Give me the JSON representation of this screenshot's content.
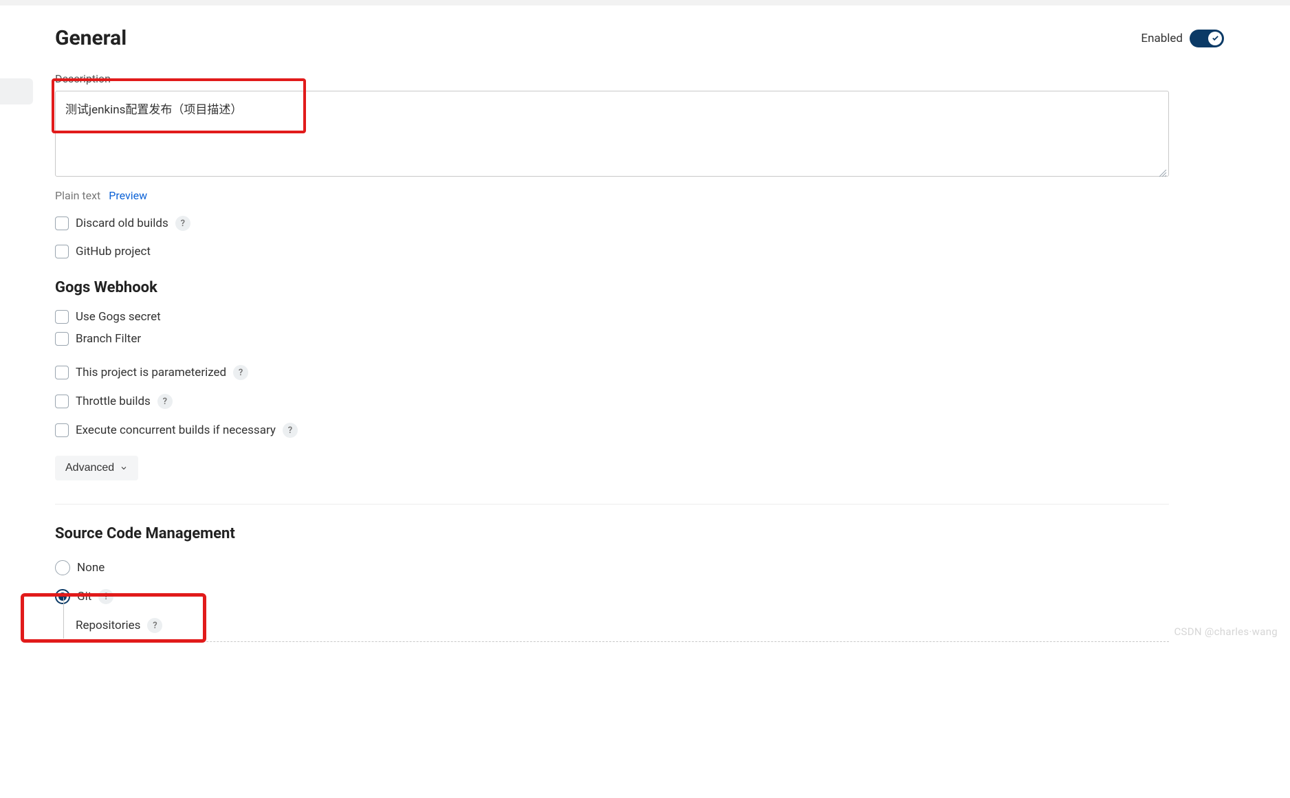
{
  "header": {
    "title": "General",
    "enabled_label": "Enabled"
  },
  "description": {
    "label": "Description",
    "value": "测试jenkins配置发布（项目描述）",
    "plain_text_label": "Plain text",
    "preview_label": "Preview"
  },
  "general_options": {
    "discard_old_builds": "Discard old builds",
    "github_project": "GitHub project"
  },
  "gogs": {
    "heading": "Gogs Webhook",
    "use_secret": "Use Gogs secret",
    "branch_filter": "Branch Filter"
  },
  "more_options": {
    "parameterized": "This project is parameterized",
    "throttle": "Throttle builds",
    "concurrent": "Execute concurrent builds if necessary",
    "advanced": "Advanced"
  },
  "scm": {
    "heading": "Source Code Management",
    "none": "None",
    "git": "Git",
    "repositories": "Repositories"
  },
  "watermark": "CSDN @charles·wang"
}
